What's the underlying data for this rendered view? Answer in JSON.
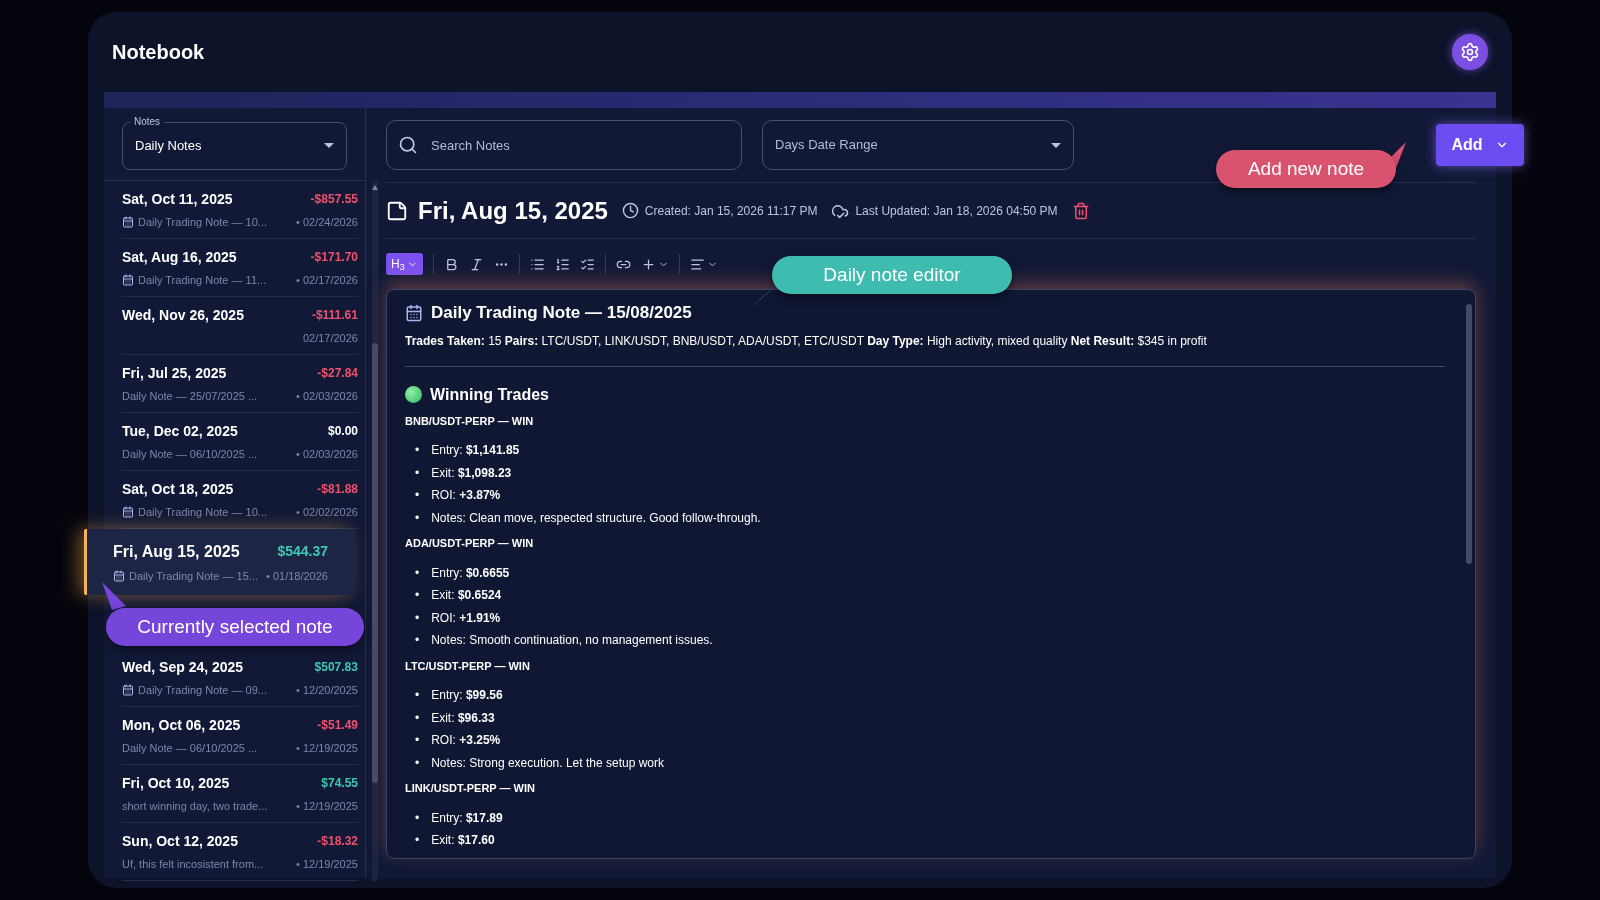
{
  "app": {
    "title": "Notebook"
  },
  "notes_filter": {
    "label": "Notes",
    "value": "Daily Notes"
  },
  "notes": [
    {
      "date": "Sat, Oct 11, 2025",
      "amount": "-$857.55",
      "color": "#f0506e",
      "calendar_icon": true,
      "title": "Daily Trading Note — 10...",
      "updated": "• 02/24/2026",
      "selected": false
    },
    {
      "date": "Sat, Aug 16, 2025",
      "amount": "-$171.70",
      "color": "#f0506e",
      "calendar_icon": true,
      "title": "Daily Trading Note — 11...",
      "updated": "• 02/17/2026",
      "selected": false
    },
    {
      "date": "Wed, Nov 26, 2025",
      "amount": "-$111.61",
      "color": "#f0506e",
      "calendar_icon": false,
      "updated": "02/17/2026",
      "selected": false
    },
    {
      "date": "Fri, Jul 25, 2025",
      "amount": "-$27.84",
      "color": "#f0506e",
      "calendar_icon": false,
      "title": "Daily Note — 25/07/2025 ...",
      "updated": "• 02/03/2026",
      "selected": false
    },
    {
      "date": "Tue, Dec 02, 2025",
      "amount": "$0.00",
      "color": "#ffffff",
      "calendar_icon": false,
      "title": "Daily Note — 06/10/2025 ...",
      "updated": "• 02/03/2026",
      "selected": false
    },
    {
      "date": "Sat, Oct 18, 2025",
      "amount": "-$81.88",
      "color": "#f0506e",
      "calendar_icon": true,
      "title": "Daily Trading Note — 10...",
      "updated": "• 02/02/2026",
      "selected": false
    },
    {
      "date": "Fri, Aug 15, 2025",
      "amount": "$544.37",
      "color": "#3cc9b0",
      "calendar_icon": true,
      "title": "Daily Trading Note — 15...",
      "updated": "• 01/18/2026",
      "selected": true
    },
    {
      "date": "Wed, Sep 24, 2025",
      "amount": "$507.83",
      "color": "#3cc9b0",
      "calendar_icon": true,
      "title": "Daily Trading Note — 09...",
      "updated": "• 12/20/2025",
      "selected": false
    },
    {
      "date": "Mon, Oct 06, 2025",
      "amount": "-$51.49",
      "color": "#f0506e",
      "calendar_icon": false,
      "title": "Daily Note — 06/10/2025 ...",
      "updated": "• 12/19/2025",
      "selected": false
    },
    {
      "date": "Fri, Oct 10, 2025",
      "amount": "$74.55",
      "color": "#3cc9b0",
      "calendar_icon": false,
      "title": "short winning day, two trade...",
      "updated": "• 12/19/2025",
      "selected": false
    },
    {
      "date": "Sun, Oct 12, 2025",
      "amount": "-$18.32",
      "color": "#f0506e",
      "calendar_icon": false,
      "title": "Uf, this felt incosistent from...",
      "updated": "• 12/19/2025",
      "selected": false
    }
  ],
  "search": {
    "placeholder": "Search Notes"
  },
  "date_range": {
    "placeholder": "Days Date Range"
  },
  "add_button": {
    "label": "Add"
  },
  "note": {
    "date": "Fri, Aug 15, 2025",
    "created": "Created: Jan 15, 2026 11:17 PM",
    "updated": "Last Updated: Jan 18, 2026 04:50 PM"
  },
  "toolbar": {
    "heading": {
      "label": "H$_{3}$",
      "active": true
    }
  },
  "document": {
    "bullet": "•",
    "heading": "Daily Trading Note — 15/08/2025",
    "summary": "**Trades Taken:** 15 **Pairs:**  LTC/USDT, LINK/USDT, BNB/USDT, ADA/USDT, ETC/USDT **Day Type:** High activity, mixed quality **Net Result:** $345 in profit",
    "sections": [
      {
        "title": "Winning Trades",
        "trades": [
          {
            "title": "BNB/USDT-PERP — WIN",
            "bullets": [
              "Entry: **$1,141.85**",
              "Exit: **$1,098.23**",
              "ROI: **+3.87%**",
              "Notes: Clean move, respected structure. Good follow-through."
            ]
          },
          {
            "title": "ADA/USDT-PERP — WIN",
            "bullets": [
              "Entry: **$0.6655**",
              "Exit: **$0.6524**",
              "ROI: **+1.91%**",
              "Notes: Smooth continuation, no management issues."
            ]
          },
          {
            "title": "LTC/USDT-PERP — WIN",
            "bullets": [
              "Entry: **$99.56**",
              "Exit: **$96.33**",
              "ROI: **+3.25%**",
              "Notes: Strong execution. Let the setup work"
            ]
          },
          {
            "title": "LINK/USDT-PERP — WIN",
            "bullets": [
              "Entry: **$17.89**",
              "Exit: **$17.60**"
            ]
          }
        ]
      }
    ]
  },
  "callouts": [
    {
      "kind": "add",
      "text": "Add new note",
      "color": "#d9536f"
    },
    {
      "kind": "editor",
      "text": "Daily note editor",
      "color": "#3fbcb0"
    },
    {
      "kind": "selected",
      "text": "Currently selected note",
      "color": "#7645d9"
    }
  ]
}
